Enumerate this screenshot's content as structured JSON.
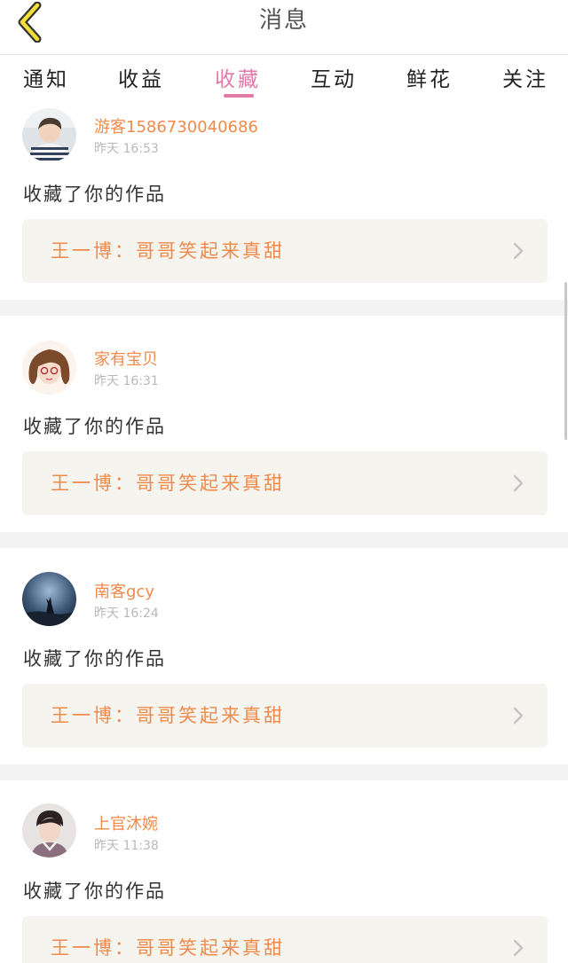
{
  "header": {
    "title": "消息"
  },
  "tabs": [
    {
      "label": "通知"
    },
    {
      "label": "收益"
    },
    {
      "label": "收藏"
    },
    {
      "label": "互动"
    },
    {
      "label": "鲜花"
    },
    {
      "label": "关注"
    }
  ],
  "active_tab": "收藏",
  "accent_color": "#e27aa9",
  "name_color": "#f08a4b",
  "items": [
    {
      "username": "游客1586730040686",
      "time": "昨天 16:53",
      "action": "收藏了你的作品",
      "work_title": "王一博：哥哥笑起来真甜",
      "avatar_icon": "boy-avatar-icon"
    },
    {
      "username": "家有宝贝",
      "time": "昨天 16:31",
      "action": "收藏了你的作品",
      "work_title": "王一博：哥哥笑起来真甜",
      "avatar_icon": "girl-avatar-icon"
    },
    {
      "username": "南客gcy",
      "time": "昨天 16:24",
      "action": "收藏了你的作品",
      "work_title": "王一博：哥哥笑起来真甜",
      "avatar_icon": "wolf-avatar-icon"
    },
    {
      "username": "上官沐婉",
      "time": "昨天 11:38",
      "action": "收藏了你的作品",
      "work_title": "王一博：哥哥笑起来真甜",
      "avatar_icon": "man-avatar-icon"
    }
  ]
}
